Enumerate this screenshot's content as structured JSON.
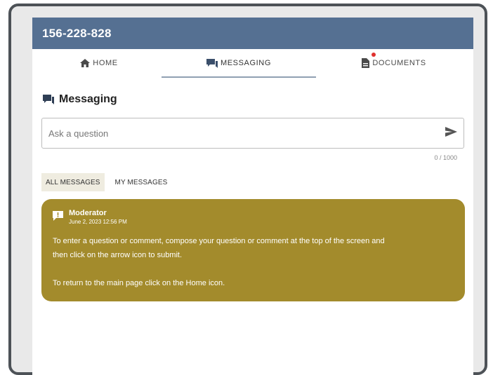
{
  "header": {
    "title": "156-228-828"
  },
  "tabs": [
    {
      "label": "HOME",
      "icon": "home-icon"
    },
    {
      "label": "MESSAGING",
      "icon": "chat-icon"
    },
    {
      "label": "DOCUMENTS",
      "icon": "document-icon"
    }
  ],
  "section": {
    "title": "Messaging",
    "icon": "chat-icon"
  },
  "ask": {
    "placeholder": "Ask a question",
    "value": "",
    "counter": "0 / 1000"
  },
  "filters": [
    {
      "label": "ALL MESSAGES",
      "active": true
    },
    {
      "label": "MY MESSAGES",
      "active": false
    }
  ],
  "message": {
    "author": "Moderator",
    "date": "June 2, 2023 12:56 PM",
    "lines": [
      "To enter a question or comment, compose your question or comment at the top of the screen and",
      "then click on the arrow icon to submit.",
      "To return to the main page click on the Home icon."
    ]
  },
  "colors": {
    "header_bg": "#557092",
    "message_bg": "#a38b2c",
    "active_filter_bg": "#efece0",
    "notification_dot": "#e0322f",
    "frame": "#4d5257"
  }
}
